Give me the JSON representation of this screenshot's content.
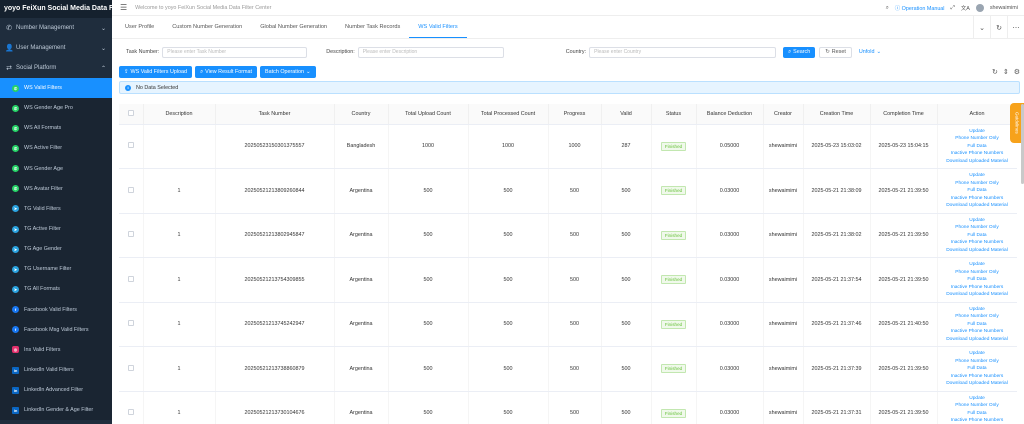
{
  "sidebar": {
    "logo": "yoyo FeiXun Social Media Data F...",
    "groups": {
      "number_management": "Number Management",
      "user_management": "User Management",
      "social_platform": "Social Platform"
    },
    "items": [
      {
        "label": "WS Valid Filters",
        "icon": "ws"
      },
      {
        "label": "WS Gender Age Pro",
        "icon": "ws"
      },
      {
        "label": "WS All Formats",
        "icon": "ws"
      },
      {
        "label": "WS Active Filter",
        "icon": "ws"
      },
      {
        "label": "WS Gender Age",
        "icon": "ws"
      },
      {
        "label": "WS Avatar Filter",
        "icon": "ws"
      },
      {
        "label": "TG Valid Filters",
        "icon": "tg"
      },
      {
        "label": "TG Active Filter",
        "icon": "tg"
      },
      {
        "label": "TG Age Gender",
        "icon": "tg"
      },
      {
        "label": "TG Username Filter",
        "icon": "tg"
      },
      {
        "label": "TG All Formats",
        "icon": "tg"
      },
      {
        "label": "Facebook Valid Filters",
        "icon": "fb"
      },
      {
        "label": "Facebook Msg Valid Filters",
        "icon": "fb"
      },
      {
        "label": "Ins Valid Filters",
        "icon": "ins"
      },
      {
        "label": "LinkedIn Valid Filters",
        "icon": "li"
      },
      {
        "label": "LinkedIn Advanced Filter",
        "icon": "li"
      },
      {
        "label": "LinkedIn Gender & Age Filter",
        "icon": "li"
      }
    ],
    "active_color": "#1890ff",
    "bg_color": "#1f2d3d"
  },
  "header": {
    "welcome": "Welcome to yoyo FeiXun Social Media Data Filter Center",
    "operation_manual": "Operation Manual",
    "username": "shewaimimi"
  },
  "tabs": [
    "User Profile",
    "Custom Number Generation",
    "Global Number Generation",
    "Number Task Records",
    "WS Valid Filters"
  ],
  "active_tab": 4,
  "search": {
    "task_number_label": "Task Number:",
    "task_number_placeholder": "Please enter Task Number",
    "description_label": "Description:",
    "description_placeholder": "Please enter Description",
    "country_label": "Country:",
    "country_placeholder": "Please enter Country",
    "search_button": "Search",
    "reset_button": "Reset",
    "unfold_button": "Unfold"
  },
  "toolbar": {
    "upload_button": "WS Valid Filters Upload",
    "view_format_button": "View Result Format",
    "batch_button": "Batch Operation"
  },
  "notice": "No Data Selected",
  "side_tab_label": "Guidelines",
  "table": {
    "columns": [
      "Description",
      "Task Number",
      "Country",
      "Total Upload Count",
      "Total Processed Count",
      "Progress",
      "Valid",
      "Status",
      "Balance Deduction",
      "Creator",
      "Creation Time",
      "Completion Time",
      "Action"
    ],
    "action_links": [
      "Update",
      "Phone Number Only",
      "Full Data",
      "Inactive Phone Numbers",
      "Download Uploaded Material"
    ],
    "rows": [
      {
        "description": "",
        "task_number": "20250523150301375557",
        "country": "Bangladesh",
        "upload": "1000",
        "processed": "1000",
        "progress": "1000",
        "valid": "287",
        "status": "Finished",
        "balance": "0.05000",
        "creator": "shewaimimi",
        "created": "2025-05-23 15:03:02",
        "completed": "2025-05-23 15:04:15"
      },
      {
        "description": "1",
        "task_number": "20250521213809260844",
        "country": "Argentina",
        "upload": "500",
        "processed": "500",
        "progress": "500",
        "valid": "500",
        "status": "Finished",
        "balance": "0.03000",
        "creator": "shewaimimi",
        "created": "2025-05-21 21:38:09",
        "completed": "2025-05-21 21:39:50"
      },
      {
        "description": "1",
        "task_number": "20250521213802945847",
        "country": "Argentina",
        "upload": "500",
        "processed": "500",
        "progress": "500",
        "valid": "500",
        "status": "Finished",
        "balance": "0.03000",
        "creator": "shewaimimi",
        "created": "2025-05-21 21:38:02",
        "completed": "2025-05-21 21:39:50"
      },
      {
        "description": "1",
        "task_number": "20250521213754309855",
        "country": "Argentina",
        "upload": "500",
        "processed": "500",
        "progress": "500",
        "valid": "500",
        "status": "Finished",
        "balance": "0.03000",
        "creator": "shewaimimi",
        "created": "2025-05-21 21:37:54",
        "completed": "2025-05-21 21:39:50"
      },
      {
        "description": "1",
        "task_number": "20250521213745242947",
        "country": "Argentina",
        "upload": "500",
        "processed": "500",
        "progress": "500",
        "valid": "500",
        "status": "Finished",
        "balance": "0.03000",
        "creator": "shewaimimi",
        "created": "2025-05-21 21:37:46",
        "completed": "2025-05-21 21:40:50"
      },
      {
        "description": "1",
        "task_number": "20250521213738860879",
        "country": "Argentina",
        "upload": "500",
        "processed": "500",
        "progress": "500",
        "valid": "500",
        "status": "Finished",
        "balance": "0.03000",
        "creator": "shewaimimi",
        "created": "2025-05-21 21:37:39",
        "completed": "2025-05-21 21:39:50"
      },
      {
        "description": "1",
        "task_number": "20250521213730104676",
        "country": "Argentina",
        "upload": "500",
        "processed": "500",
        "progress": "500",
        "valid": "500",
        "status": "Finished",
        "balance": "0.03000",
        "creator": "shewaimimi",
        "created": "2025-05-21 21:37:31",
        "completed": "2025-05-21 21:39:50"
      }
    ]
  }
}
